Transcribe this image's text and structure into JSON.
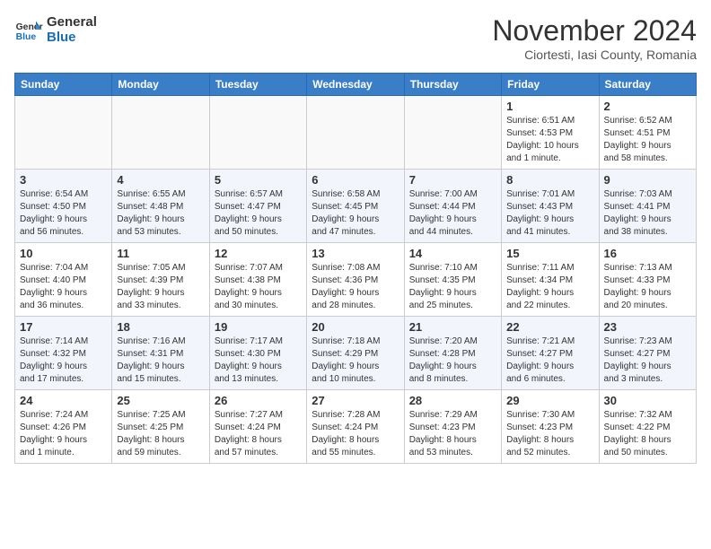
{
  "logo": {
    "line1": "General",
    "line2": "Blue"
  },
  "title": "November 2024",
  "location": "Ciortesti, Iasi County, Romania",
  "weekdays": [
    "Sunday",
    "Monday",
    "Tuesday",
    "Wednesday",
    "Thursday",
    "Friday",
    "Saturday"
  ],
  "weeks": [
    [
      {
        "day": "",
        "info": ""
      },
      {
        "day": "",
        "info": ""
      },
      {
        "day": "",
        "info": ""
      },
      {
        "day": "",
        "info": ""
      },
      {
        "day": "",
        "info": ""
      },
      {
        "day": "1",
        "info": "Sunrise: 6:51 AM\nSunset: 4:53 PM\nDaylight: 10 hours\nand 1 minute."
      },
      {
        "day": "2",
        "info": "Sunrise: 6:52 AM\nSunset: 4:51 PM\nDaylight: 9 hours\nand 58 minutes."
      }
    ],
    [
      {
        "day": "3",
        "info": "Sunrise: 6:54 AM\nSunset: 4:50 PM\nDaylight: 9 hours\nand 56 minutes."
      },
      {
        "day": "4",
        "info": "Sunrise: 6:55 AM\nSunset: 4:48 PM\nDaylight: 9 hours\nand 53 minutes."
      },
      {
        "day": "5",
        "info": "Sunrise: 6:57 AM\nSunset: 4:47 PM\nDaylight: 9 hours\nand 50 minutes."
      },
      {
        "day": "6",
        "info": "Sunrise: 6:58 AM\nSunset: 4:45 PM\nDaylight: 9 hours\nand 47 minutes."
      },
      {
        "day": "7",
        "info": "Sunrise: 7:00 AM\nSunset: 4:44 PM\nDaylight: 9 hours\nand 44 minutes."
      },
      {
        "day": "8",
        "info": "Sunrise: 7:01 AM\nSunset: 4:43 PM\nDaylight: 9 hours\nand 41 minutes."
      },
      {
        "day": "9",
        "info": "Sunrise: 7:03 AM\nSunset: 4:41 PM\nDaylight: 9 hours\nand 38 minutes."
      }
    ],
    [
      {
        "day": "10",
        "info": "Sunrise: 7:04 AM\nSunset: 4:40 PM\nDaylight: 9 hours\nand 36 minutes."
      },
      {
        "day": "11",
        "info": "Sunrise: 7:05 AM\nSunset: 4:39 PM\nDaylight: 9 hours\nand 33 minutes."
      },
      {
        "day": "12",
        "info": "Sunrise: 7:07 AM\nSunset: 4:38 PM\nDaylight: 9 hours\nand 30 minutes."
      },
      {
        "day": "13",
        "info": "Sunrise: 7:08 AM\nSunset: 4:36 PM\nDaylight: 9 hours\nand 28 minutes."
      },
      {
        "day": "14",
        "info": "Sunrise: 7:10 AM\nSunset: 4:35 PM\nDaylight: 9 hours\nand 25 minutes."
      },
      {
        "day": "15",
        "info": "Sunrise: 7:11 AM\nSunset: 4:34 PM\nDaylight: 9 hours\nand 22 minutes."
      },
      {
        "day": "16",
        "info": "Sunrise: 7:13 AM\nSunset: 4:33 PM\nDaylight: 9 hours\nand 20 minutes."
      }
    ],
    [
      {
        "day": "17",
        "info": "Sunrise: 7:14 AM\nSunset: 4:32 PM\nDaylight: 9 hours\nand 17 minutes."
      },
      {
        "day": "18",
        "info": "Sunrise: 7:16 AM\nSunset: 4:31 PM\nDaylight: 9 hours\nand 15 minutes."
      },
      {
        "day": "19",
        "info": "Sunrise: 7:17 AM\nSunset: 4:30 PM\nDaylight: 9 hours\nand 13 minutes."
      },
      {
        "day": "20",
        "info": "Sunrise: 7:18 AM\nSunset: 4:29 PM\nDaylight: 9 hours\nand 10 minutes."
      },
      {
        "day": "21",
        "info": "Sunrise: 7:20 AM\nSunset: 4:28 PM\nDaylight: 9 hours\nand 8 minutes."
      },
      {
        "day": "22",
        "info": "Sunrise: 7:21 AM\nSunset: 4:27 PM\nDaylight: 9 hours\nand 6 minutes."
      },
      {
        "day": "23",
        "info": "Sunrise: 7:23 AM\nSunset: 4:27 PM\nDaylight: 9 hours\nand 3 minutes."
      }
    ],
    [
      {
        "day": "24",
        "info": "Sunrise: 7:24 AM\nSunset: 4:26 PM\nDaylight: 9 hours\nand 1 minute."
      },
      {
        "day": "25",
        "info": "Sunrise: 7:25 AM\nSunset: 4:25 PM\nDaylight: 8 hours\nand 59 minutes."
      },
      {
        "day": "26",
        "info": "Sunrise: 7:27 AM\nSunset: 4:24 PM\nDaylight: 8 hours\nand 57 minutes."
      },
      {
        "day": "27",
        "info": "Sunrise: 7:28 AM\nSunset: 4:24 PM\nDaylight: 8 hours\nand 55 minutes."
      },
      {
        "day": "28",
        "info": "Sunrise: 7:29 AM\nSunset: 4:23 PM\nDaylight: 8 hours\nand 53 minutes."
      },
      {
        "day": "29",
        "info": "Sunrise: 7:30 AM\nSunset: 4:23 PM\nDaylight: 8 hours\nand 52 minutes."
      },
      {
        "day": "30",
        "info": "Sunrise: 7:32 AM\nSunset: 4:22 PM\nDaylight: 8 hours\nand 50 minutes."
      }
    ]
  ]
}
